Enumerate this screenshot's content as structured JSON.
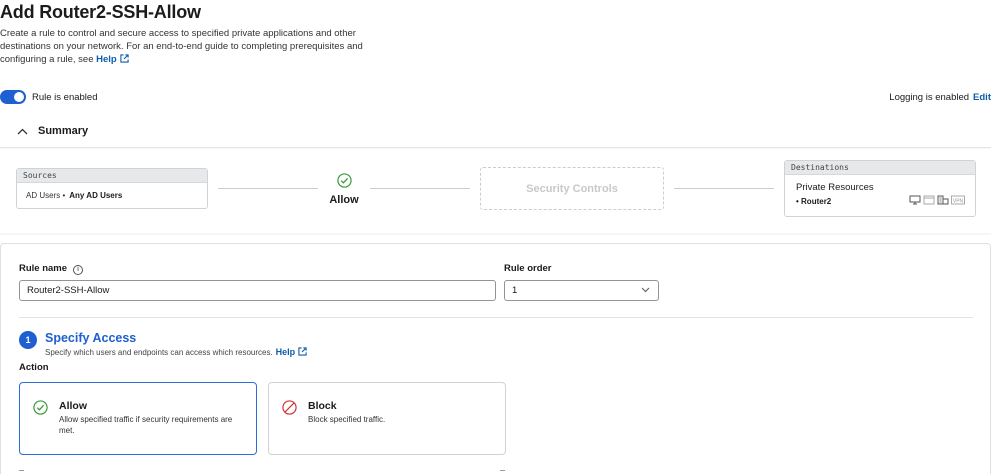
{
  "page": {
    "title": "Add Router2-SSH-Allow",
    "description": "Create a rule to control and secure access to specified private applications and other destinations on your network. For an end-to-end guide to completing prerequisites and configuring a rule, see",
    "help_link": "Help"
  },
  "rule_status": {
    "toggle_label": "Rule is enabled",
    "logging_text": "Logging is enabled",
    "logging_edit": "Edit"
  },
  "summary": {
    "heading": "Summary",
    "sources_header": "Sources",
    "source_type": "AD Users",
    "source_value": "Any AD Users",
    "action": "Allow",
    "security_controls": "Security Controls",
    "destinations_header": "Destinations",
    "destination_type": "Private Resources",
    "destination_value": "Router2",
    "destination_icons": [
      "monitor-icon",
      "window-icon",
      "building-icon",
      "vpn-icon"
    ],
    "vpn_icon_text": "VPN"
  },
  "form": {
    "rule_name_label": "Rule name",
    "rule_name_value": "Router2-SSH-Allow",
    "rule_order_label": "Rule order",
    "rule_order_value": "1"
  },
  "specify_access": {
    "step_number": "1",
    "title": "Specify Access",
    "subtitle": "Specify which users and endpoints can access which resources.",
    "help_link": "Help",
    "action_label": "Action",
    "options": [
      {
        "title": "Allow",
        "description": "Allow specified traffic if security requirements are met.",
        "selected": true
      },
      {
        "title": "Block",
        "description": "Block specified traffic.",
        "selected": false
      }
    ]
  },
  "colors": {
    "accent": "#1e5fd1",
    "link": "#0d5cab",
    "allow_green": "#3a9b3a",
    "block_red": "#d0343a"
  }
}
